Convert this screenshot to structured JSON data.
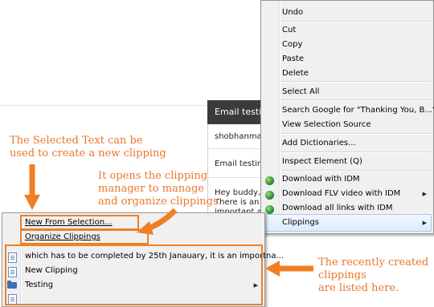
{
  "background": {
    "email_header": "Email testin",
    "lines": [
      "shobhanma",
      "Email testin",
      "Hey buddy,",
      "There is an",
      "important a"
    ]
  },
  "context_menu": {
    "items": {
      "undo": "Undo",
      "cut": "Cut",
      "copy": "Copy",
      "paste": "Paste",
      "delete": "Delete",
      "select_all": "Select All",
      "search_google": "Search Google for \"Thanking You, B...\"",
      "view_source": "View Selection Source",
      "add_dictionaries": "Add Dictionaries...",
      "inspect": "Inspect Element (Q)",
      "download_idm": "Download with IDM",
      "download_flv": "Download FLV video with IDM",
      "download_all": "Download all links with IDM",
      "clippings": "Clippings"
    }
  },
  "clippings_menu": {
    "new_from_selection": "New From Selection...",
    "organize": "Organize Clippings",
    "entries": [
      "which has to be completed by 25th Janauary, it is an importna...",
      "New Clipping",
      "Testing",
      ""
    ]
  },
  "annotations": {
    "selected_text": [
      "The Selected Text can be",
      "used to create a new clipping"
    ],
    "manager": [
      "It opens the clipping",
      "manager to manage",
      "and organize clippings."
    ],
    "recent": [
      "The recently created",
      "clippings",
      "are listed here."
    ]
  },
  "colors": {
    "annotation": "#f07f24",
    "menu_bg": "#f0f0f0",
    "email_header_bg": "#3b3b3b"
  }
}
